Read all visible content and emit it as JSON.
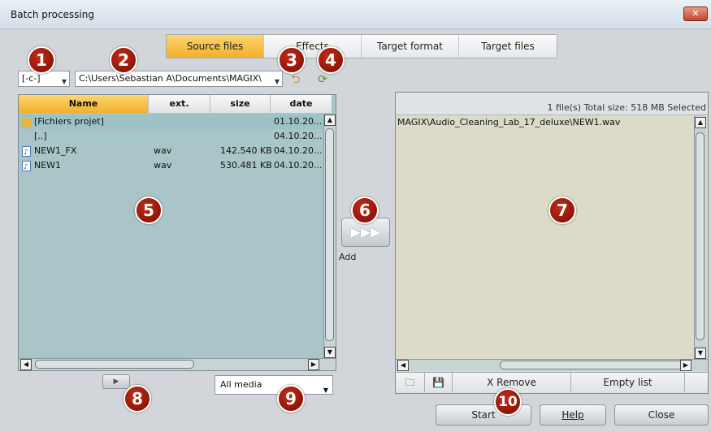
{
  "window": {
    "title": "Batch processing",
    "close_glyph": "✕"
  },
  "tabs": [
    {
      "label": "Source files",
      "active": true
    },
    {
      "label": "Effects",
      "active": false
    },
    {
      "label": "Target format",
      "active": false
    },
    {
      "label": "Target files",
      "active": false
    }
  ],
  "source": {
    "drive": "[-c-]",
    "path": "C:\\Users\\Sebastian A\\Documents\\MAGIX\\",
    "columns": [
      "Name",
      "ext.",
      "size",
      "date"
    ],
    "rows": [
      {
        "icon": "folder-icon",
        "name": "[Fichiers projet]",
        "ext": "",
        "size": "",
        "date": "01.10.20..."
      },
      {
        "icon": "",
        "name": "[..]",
        "ext": "",
        "size": "",
        "date": "04.10.20..."
      },
      {
        "icon": "audio-file-icon",
        "name": "NEW1_FX",
        "ext": "wav",
        "size": "142.540 KB",
        "date": "04.10.20..."
      },
      {
        "icon": "audio-file-icon",
        "name": "NEW1",
        "ext": "wav",
        "size": "530.481 KB",
        "date": "04.10.20..."
      }
    ]
  },
  "add_button": {
    "glyph": "▶▶▶",
    "label": "Add"
  },
  "target": {
    "info": "1 file(s) Total size: 518 MB Selected",
    "files": [
      "MAGIX\\Audio_Cleaning_Lab_17_deluxe\\NEW1.wav"
    ],
    "remove_label": "X Remove",
    "empty_label": "Empty list"
  },
  "media_filter": {
    "selected": "All media"
  },
  "buttons": {
    "start": "Start",
    "help": "Help",
    "close": "Close"
  },
  "badges": [
    "1",
    "2",
    "3",
    "4",
    "5",
    "6",
    "7",
    "8",
    "9",
    "10"
  ],
  "colors": {
    "accent": "#f1b02b",
    "badge": "#a11a0a",
    "list_bg": "#a9c5c7",
    "target_bg": "#dcdbc8"
  }
}
